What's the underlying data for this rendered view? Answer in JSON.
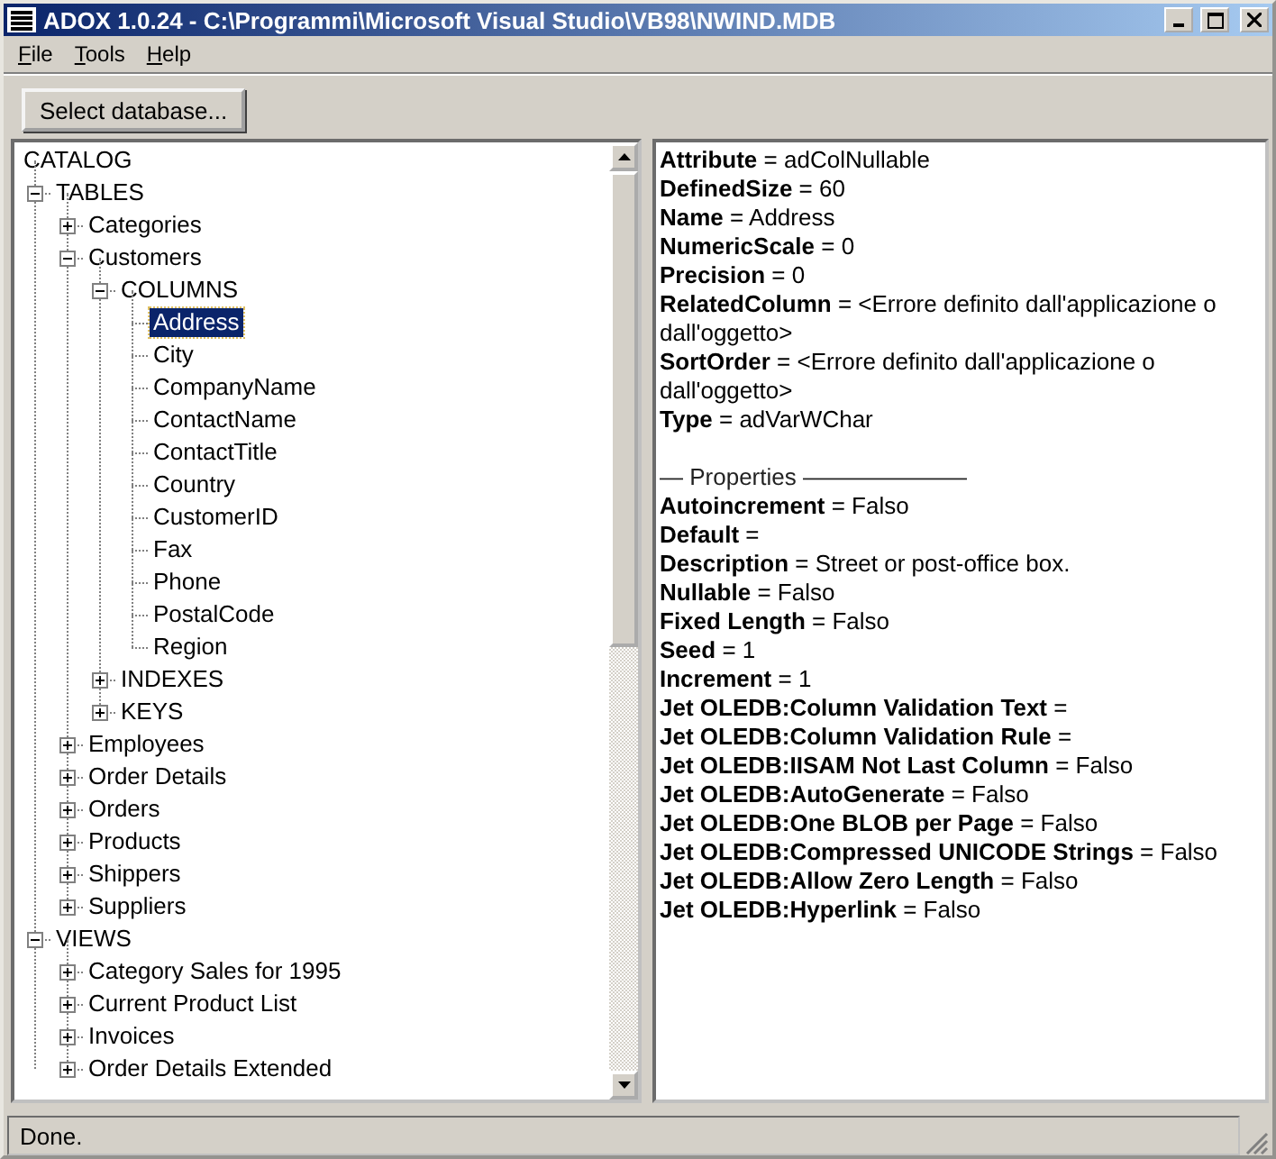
{
  "window": {
    "title": "ADOX 1.0.24 - C:\\Programmi\\Microsoft Visual Studio\\VB98\\NWIND.MDB"
  },
  "menu": [
    {
      "label": "File"
    },
    {
      "label": "Tools"
    },
    {
      "label": "Help"
    }
  ],
  "toolbar": {
    "button": "Select database..."
  },
  "tree": {
    "label": "CATALOG",
    "selected": false,
    "children": [
      {
        "label": "TABLES",
        "selected": false,
        "expanded": true,
        "children": [
          {
            "label": "Categories",
            "selected": false,
            "expanded": false
          },
          {
            "label": "Customers",
            "selected": false,
            "expanded": true,
            "children": [
              {
                "label": "COLUMNS",
                "selected": false,
                "expanded": true,
                "children": [
                  {
                    "label": "Address",
                    "selected": true
                  },
                  {
                    "label": "City",
                    "selected": false
                  },
                  {
                    "label": "CompanyName",
                    "selected": false
                  },
                  {
                    "label": "ContactName",
                    "selected": false
                  },
                  {
                    "label": "ContactTitle",
                    "selected": false
                  },
                  {
                    "label": "Country",
                    "selected": false
                  },
                  {
                    "label": "CustomerID",
                    "selected": false
                  },
                  {
                    "label": "Fax",
                    "selected": false
                  },
                  {
                    "label": "Phone",
                    "selected": false
                  },
                  {
                    "label": "PostalCode",
                    "selected": false
                  },
                  {
                    "label": "Region",
                    "selected": false
                  }
                ]
              },
              {
                "label": "INDEXES",
                "selected": false,
                "expanded": false
              },
              {
                "label": "KEYS",
                "selected": false,
                "expanded": false
              }
            ]
          },
          {
            "label": "Employees",
            "selected": false,
            "expanded": false
          },
          {
            "label": "Order Details",
            "selected": false,
            "expanded": false
          },
          {
            "label": "Orders",
            "selected": false,
            "expanded": false
          },
          {
            "label": "Products",
            "selected": false,
            "expanded": false
          },
          {
            "label": "Shippers",
            "selected": false,
            "expanded": false
          },
          {
            "label": "Suppliers",
            "selected": false,
            "expanded": false
          }
        ]
      },
      {
        "label": "VIEWS",
        "selected": false,
        "expanded": true,
        "children": [
          {
            "label": "Category Sales for 1995",
            "selected": false,
            "expanded": false
          },
          {
            "label": "Current Product List",
            "selected": false,
            "expanded": false
          },
          {
            "label": "Invoices",
            "selected": false,
            "expanded": false
          },
          {
            "label": "Order Details Extended",
            "selected": false,
            "expanded": false
          }
        ]
      }
    ]
  },
  "details": [
    {
      "kind": "property",
      "text": "**Attribute** = adColNullable"
    },
    {
      "kind": "property",
      "text": "**DefinedSize** = 60"
    },
    {
      "kind": "property",
      "text": "**Name** = Address"
    },
    {
      "kind": "property",
      "text": "**NumericScale** = 0"
    },
    {
      "kind": "property",
      "text": "**Precision** = 0"
    },
    {
      "kind": "property",
      "text": "**RelatedColumn** = <Errore definito dall'applicazione o dall'oggetto>"
    },
    {
      "kind": "property",
      "text": "**SortOrder** = <Errore definito dall'applicazione o dall'oggetto>"
    },
    {
      "kind": "property",
      "text": "**Type** = adVarWChar"
    },
    {
      "kind": "heading",
      "text": "— Properties ———————"
    },
    {
      "kind": "property",
      "text": "**Autoincrement** = Falso"
    },
    {
      "kind": "property",
      "text": "**Default** ="
    },
    {
      "kind": "property",
      "text": "**Description** = Street or post-office box."
    },
    {
      "kind": "property",
      "text": "**Nullable** = Falso"
    },
    {
      "kind": "property",
      "text": "**Fixed Length** = Falso"
    },
    {
      "kind": "property",
      "text": "**Seed** = 1"
    },
    {
      "kind": "property",
      "text": "**Increment** = 1"
    },
    {
      "kind": "property",
      "text": "**Jet OLEDB:Column Validation Text** ="
    },
    {
      "kind": "property",
      "text": "**Jet OLEDB:Column Validation Rule** ="
    },
    {
      "kind": "property",
      "text": "**Jet OLEDB:IISAM Not Last Column** = Falso"
    },
    {
      "kind": "property",
      "text": "**Jet OLEDB:AutoGenerate** = Falso"
    },
    {
      "kind": "property",
      "text": "**Jet OLEDB:One BLOB per Page** = Falso"
    },
    {
      "kind": "property",
      "text": "**Jet OLEDB:Compressed UNICODE Strings** = Falso"
    },
    {
      "kind": "property",
      "text": "**Jet OLEDB:Allow Zero Length** = Falso"
    },
    {
      "kind": "property",
      "text": "**Jet OLEDB:Hyperlink** = Falso"
    }
  ],
  "status_bar": {
    "text": "Done."
  }
}
